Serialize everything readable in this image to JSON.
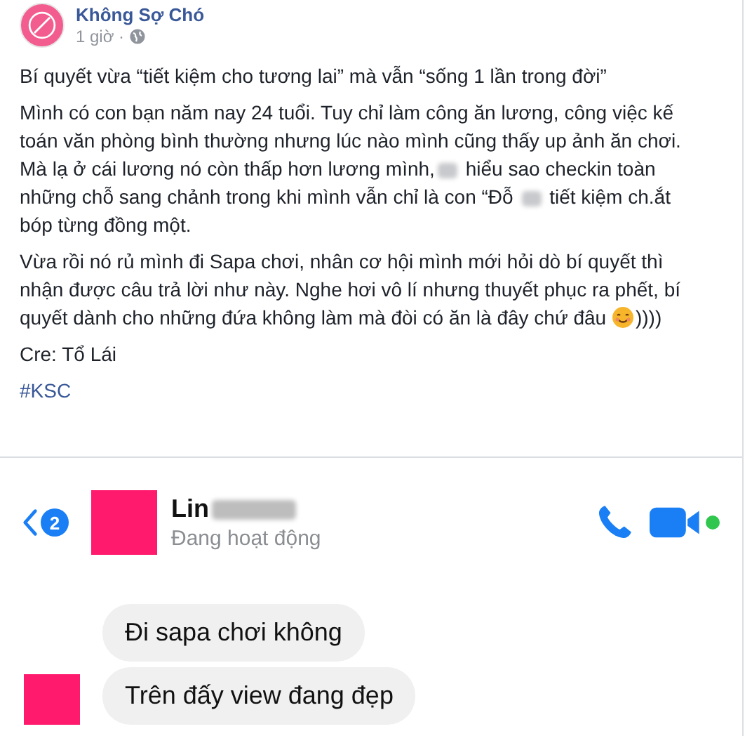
{
  "post": {
    "page_name": "Không Sợ Chó",
    "time": "1 giờ ·",
    "paragraphs": [
      {
        "segments": [
          {
            "kind": "text",
            "text": "Bí quyết vừa “tiết kiệm cho tương lai” mà vẫn “sống 1 lần trong đời”"
          }
        ]
      },
      {
        "segments": [
          {
            "kind": "text",
            "text": "Mình có con bạn năm nay 24 tuổi. Tuy chỉ làm công ăn lương, công việc kế toán văn phòng bình thường nhưng lúc nào mình cũng thấy up ảnh ăn chơi. Mà lạ ở cái lương nó còn thấp hơn lương mình,"
          },
          {
            "kind": "redaction"
          },
          {
            "kind": "text",
            "text": " hiểu sao checkin toàn những chỗ sang chảnh trong khi mình vẫn chỉ là con “Đỗ "
          },
          {
            "kind": "redaction"
          },
          {
            "kind": "text",
            "text": " tiết kiệm ch.ắt bóp từng đồng một."
          }
        ]
      },
      {
        "segments": [
          {
            "kind": "text",
            "text": "Vừa rồi nó rủ mình đi Sapa chơi, nhân cơ hội mình mới hỏi dò bí quyết thì nhận được câu trả lời như này. Nghe hơi vô lí nhưng thuyết phục ra phết, bí quyết dành cho những đứa không làm mà đòi có ăn là đây chứ đâu "
          },
          {
            "kind": "emoji"
          },
          {
            "kind": "text",
            "text": "))))"
          }
        ]
      },
      {
        "segments": [
          {
            "kind": "text",
            "text": "Cre: Tổ Lái"
          }
        ]
      },
      {
        "segments": [
          {
            "kind": "hashtag",
            "text": "#KSC"
          }
        ]
      }
    ]
  },
  "chat": {
    "unread": "2",
    "contact_name": "Lin",
    "status": "Đang hoạt động",
    "online": true,
    "messages": [
      {
        "text": "Đi sapa chơi không",
        "show_avatar": false
      },
      {
        "text": "Trên đấy view đang đẹp",
        "show_avatar": true
      }
    ]
  }
}
